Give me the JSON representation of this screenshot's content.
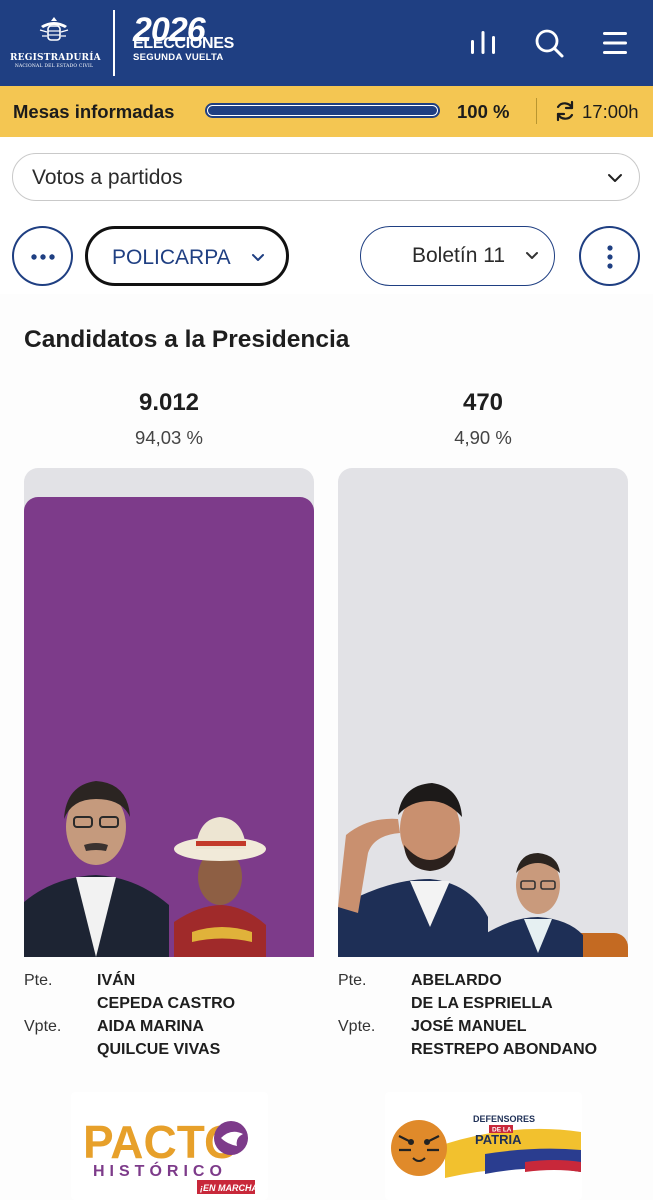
{
  "header": {
    "org_name": "REGISTRADURÍA",
    "org_sub": "NACIONAL DEL ESTADO CIVIL",
    "election_year": "2026",
    "election_title": "ELECCIONES",
    "election_round": "SEGUNDA VUELTA",
    "icons": [
      "bar-chart-icon",
      "search-icon",
      "hamburger-menu-icon"
    ]
  },
  "status": {
    "label": "Mesas informadas",
    "progress_percent": 100,
    "progress_text": "100 %",
    "time": "17:00h",
    "colors": {
      "bar_bg": "#f4c652",
      "progress": "#1f3f82"
    }
  },
  "filters": {
    "vote_type": "Votos a partidos",
    "department": "POLICARPA",
    "bulletin": "Boletín 11"
  },
  "section": {
    "title": "Candidatos a la Presidencia",
    "candidates": [
      {
        "votes": "9.012",
        "percent_text": "94,03 %",
        "percent": 94.03,
        "bar_color": "#7d3b8a",
        "president_role": "Pte.",
        "president_line1": "IVÁN",
        "president_line2": "CEPEDA CASTRO",
        "vp_role": "Vpte.",
        "vp_line1": "AIDA MARINA",
        "vp_line2": "QUILCUE VIVAS",
        "party_line1": "PACTO",
        "party_line2": "HISTÓRICO",
        "party_line3": "¡EN MARCHA!"
      },
      {
        "votes": "470",
        "percent_text": "4,90 %",
        "percent": 4.9,
        "bar_color": "#c46a22",
        "president_role": "Pte.",
        "president_line1": "ABELARDO",
        "president_line2": "DE LA ESPRIELLA",
        "vp_role": "Vpte.",
        "vp_line1": "JOSÉ MANUEL",
        "vp_line2": "RESTREPO ABONDANO",
        "party_line1": "DEFENSORES",
        "party_line2": "DE LA",
        "party_line3": "PATRIA"
      }
    ]
  }
}
